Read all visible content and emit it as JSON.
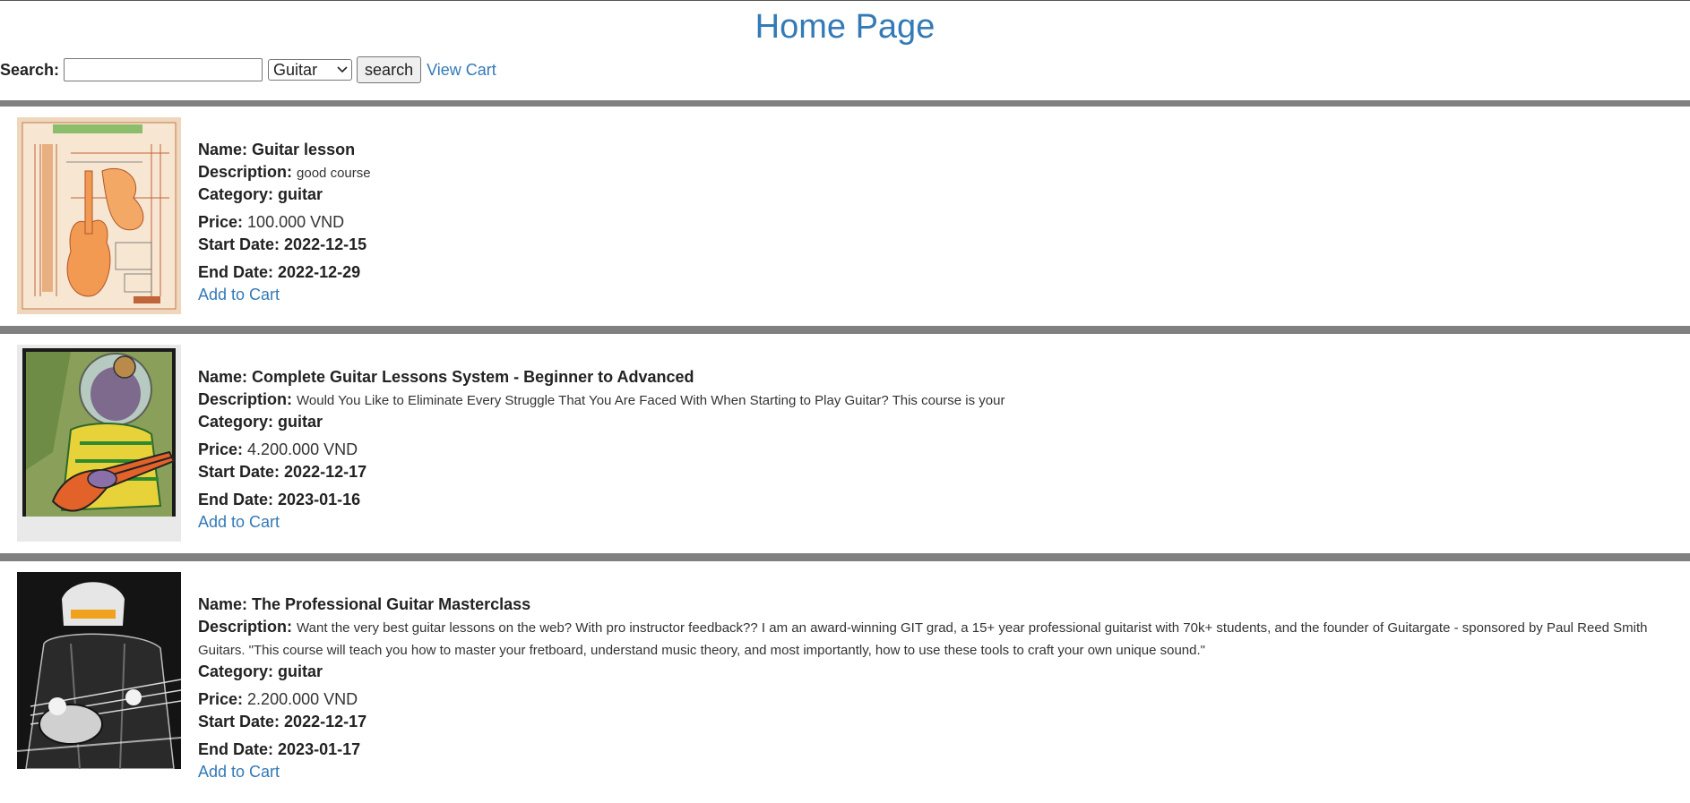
{
  "page": {
    "title": "Home Page"
  },
  "search": {
    "label": "Search:",
    "value": "",
    "placeholder": "",
    "category": "Guitar",
    "button": "search",
    "view_cart": "View Cart"
  },
  "labels": {
    "name": "Name:",
    "description": "Description:",
    "category": "Category:",
    "price": "Price:",
    "start_date": "Start Date:",
    "end_date": "End Date:",
    "add_to_cart": "Add to Cart"
  },
  "products": [
    {
      "name": "Guitar lesson",
      "description": "good course",
      "category": "guitar",
      "price": "100.000 VND",
      "start_date": "2022-12-15",
      "end_date": "2022-12-29",
      "image": "guitar-blueprint-icon"
    },
    {
      "name": "Complete Guitar Lessons System - Beginner to Advanced",
      "description": "Would You Like to Eliminate Every Struggle That You Are Faced With When Starting to Play Guitar? This course is your",
      "category": "guitar",
      "price": "4.200.000 VND",
      "start_date": "2022-12-17",
      "end_date": "2023-01-16",
      "image": "alien-bassist-icon"
    },
    {
      "name": "The Professional Guitar Masterclass",
      "description": "Want the very best guitar lessons on the web? With pro instructor feedback?? I am an award-winning GIT grad, a 15+ year professional guitarist with 70k+ students, and the founder of Guitargate - sponsored by Paul Reed Smith Guitars. \"This course will teach you how to master your fretboard, understand music theory, and most importantly, how to use these tools to craft your own unique sound.\"",
      "category": "guitar",
      "price": "2.200.000 VND",
      "start_date": "2022-12-17",
      "end_date": "2023-01-17",
      "image": "helmet-guitarist-icon"
    }
  ],
  "colors": {
    "link": "#337ab7",
    "divider": "#808080"
  }
}
